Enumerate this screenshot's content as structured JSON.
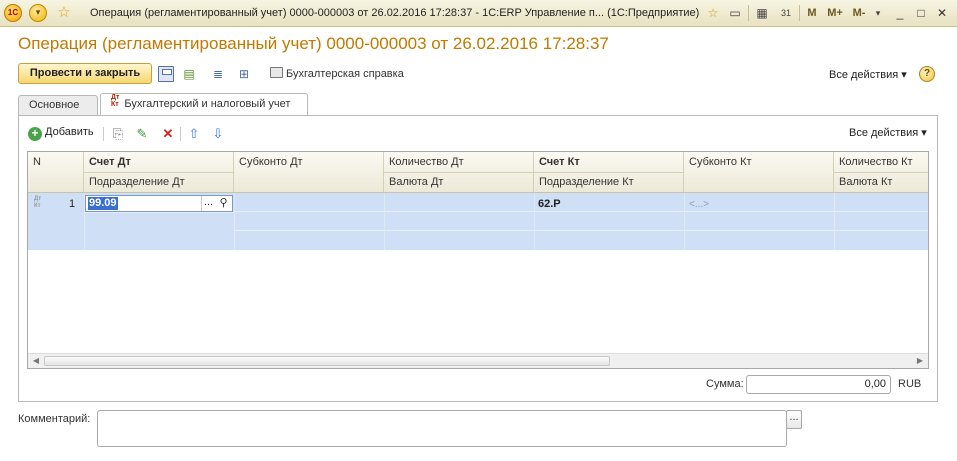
{
  "window": {
    "title": "Операция (регламентированный учет) 0000-000003 от 26.02.2016 17:28:37 - 1С:ERP Управление п...  (1С:Предприятие)",
    "logo_text": "1С",
    "m_buttons": [
      "M",
      "M+",
      "M-"
    ],
    "minimize": "_",
    "maximize": "□",
    "close": "✕"
  },
  "form": {
    "title": "Операция (регламентированный учет) 0000-000003 от 26.02.2016 17:28:37"
  },
  "toolbar": {
    "post_close_label": "Провести и закрыть",
    "print_label": "Бухгалтерская справка",
    "all_actions_label": "Все действия ▾",
    "help_label": "?"
  },
  "tabs": [
    {
      "label": "Основное",
      "active": false
    },
    {
      "label": "Бухгалтерский и налоговый учет",
      "active": true,
      "icon_top": "Дт",
      "icon_bottom": "Кт"
    }
  ],
  "grid_toolbar": {
    "add_label": "Добавить",
    "all_actions_label": "Все действия ▾"
  },
  "grid": {
    "headers": {
      "n": "N",
      "schet_dt": "Счет Дт",
      "podrazd_dt": "Подразделение Дт",
      "subkonto_dt": "Субконто Дт",
      "kolvo_dt": "Количество Дт",
      "valuta_dt": "Валюта Дт",
      "schet_kt": "Счет Кт",
      "podrazd_kt": "Подразделение Кт",
      "subkonto_kt": "Субконто Кт",
      "kolvo_kt": "Количество Кт",
      "valuta_kt": "Валюта Кт"
    },
    "rows": [
      {
        "icon_top": "Дт",
        "icon_bottom": "Кт",
        "n": "1",
        "schet_dt": "99.09",
        "schet_kt": "62.Р",
        "subkonto_kt": "<...>"
      }
    ]
  },
  "sum": {
    "label": "Сумма:",
    "value": "0,00",
    "currency": "RUB"
  },
  "comment": {
    "label": "Комментарий:",
    "value": ""
  }
}
